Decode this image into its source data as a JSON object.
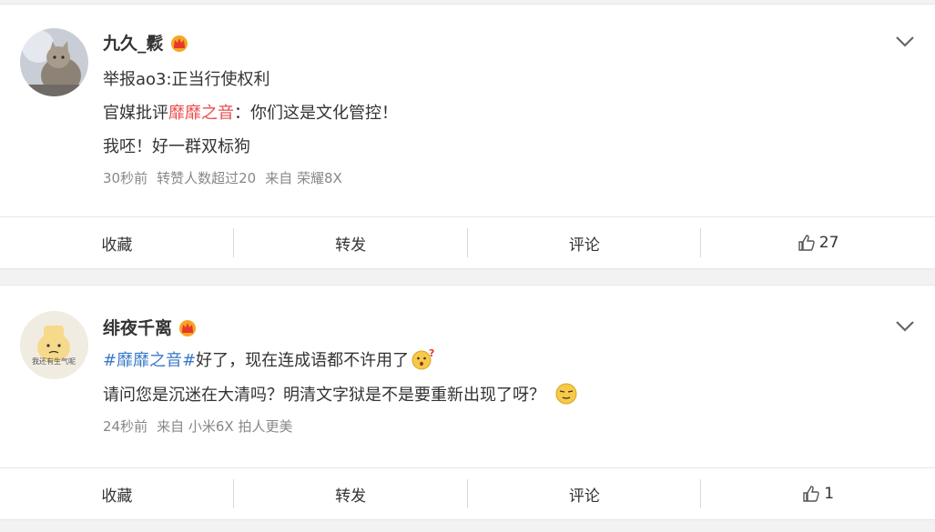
{
  "posts": [
    {
      "username": "九久_鬏",
      "lines": [
        {
          "text": "举报ao3:正当行使权利"
        },
        {
          "prefix": "官媒批评",
          "highlight": "靡靡之音",
          "suffix": "：你们这是文化管控！"
        },
        {
          "text": "我呸！好一群双标狗"
        }
      ],
      "meta": {
        "time": "30秒前",
        "extra": "转赞人数超过20",
        "source": "来自 荣耀8X"
      },
      "actions": {
        "fav": "收藏",
        "repost": "转发",
        "comment": "评论",
        "likes": "27"
      }
    },
    {
      "username": "绯夜千离",
      "avatar_text": "我还有生气呢",
      "lines": [
        {
          "tag": "#靡靡之音#",
          "suffix": "好了，现在连成语都不许用了"
        },
        {
          "text": "请问您是沉迷在大清吗？明清文字狱是不是要重新出现了呀？"
        }
      ],
      "meta": {
        "time": "24秒前",
        "source": "来自 小米6X 拍人更美"
      },
      "actions": {
        "fav": "收藏",
        "repost": "转发",
        "comment": "评论",
        "likes": "1"
      }
    }
  ]
}
